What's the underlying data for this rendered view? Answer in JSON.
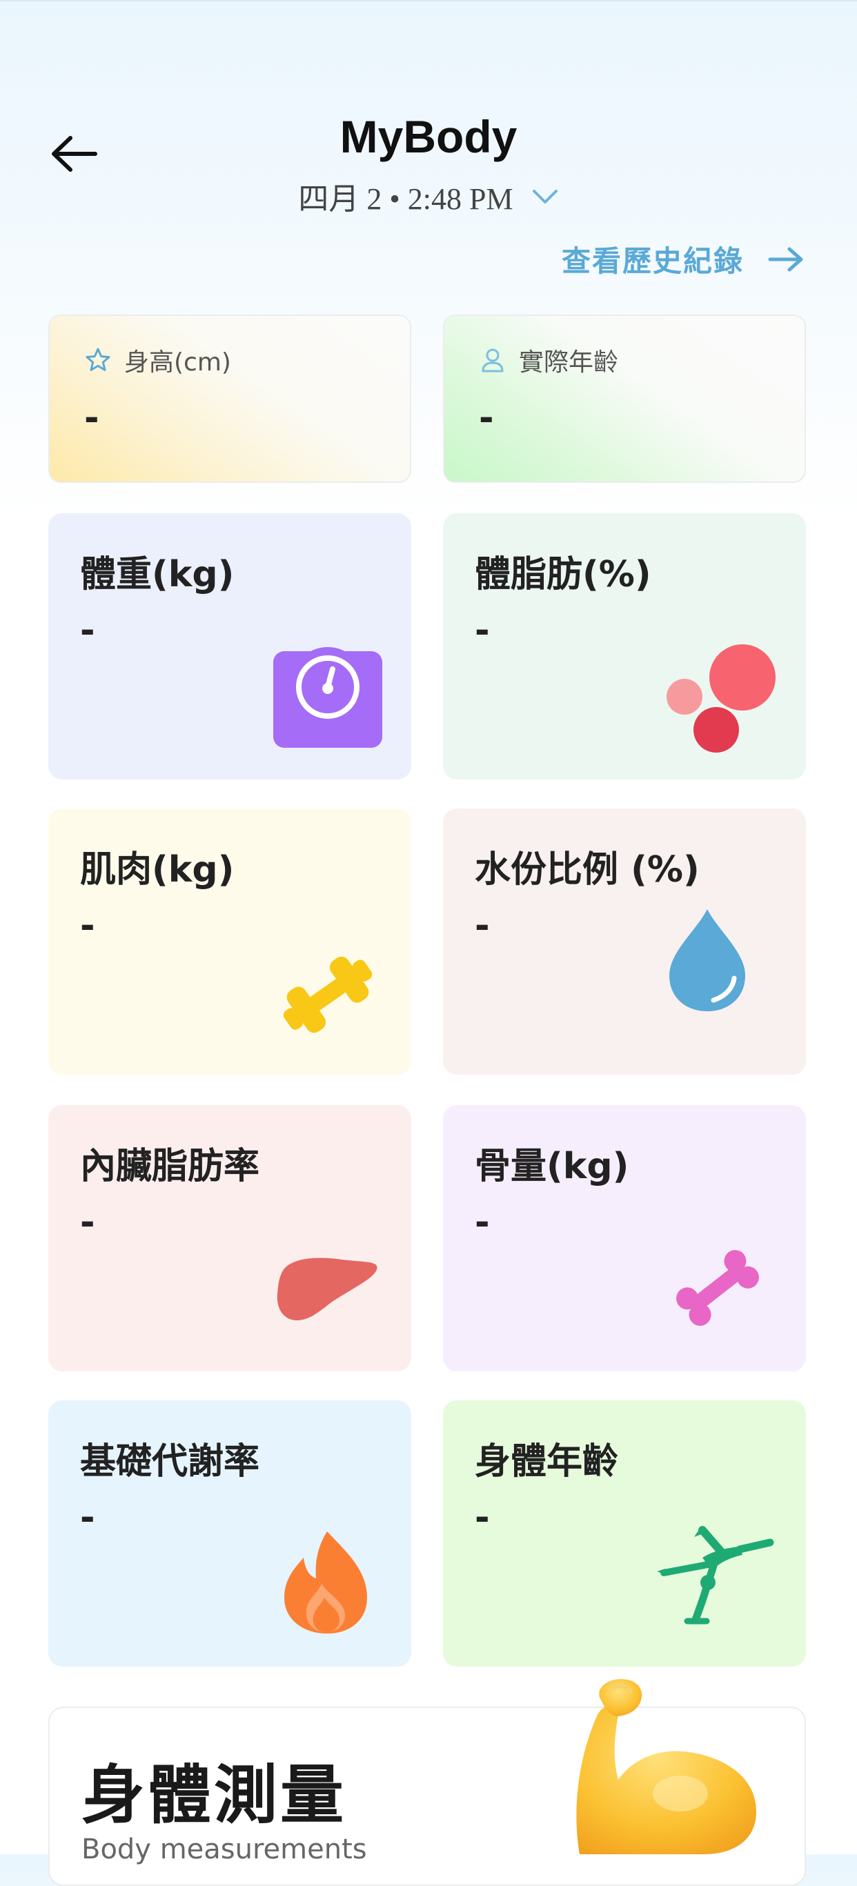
{
  "header": {
    "title": "MyBody",
    "date": "四月 2 • 2:48 PM",
    "history_link": "查看歷史紀錄"
  },
  "info_cards": [
    {
      "label": "身高(cm)",
      "value": "-",
      "icon": "star-icon"
    },
    {
      "label": "實際年齡",
      "value": "-",
      "icon": "person-icon"
    }
  ],
  "metrics": [
    {
      "title": "體重(kg)",
      "value": "-",
      "icon": "scale-icon",
      "color": "#a56cf7",
      "bg": "#ecf0fd"
    },
    {
      "title": "體脂肪(%)",
      "value": "-",
      "icon": "fat-cells-icon",
      "color": "#f2626e",
      "bg": "#ecf7f2"
    },
    {
      "title": "肌肉(kg)",
      "value": "-",
      "icon": "dumbbell-icon",
      "color": "#f9c816",
      "bg": "#fffbeb"
    },
    {
      "title": "水份比例 (%)",
      "value": "-",
      "icon": "water-drop-icon",
      "color": "#5aa9d6",
      "bg": "#f8f1f0"
    },
    {
      "title": "內臟脂肪率",
      "value": "-",
      "icon": "liver-icon",
      "color": "#e46762",
      "bg": "#fdeeee"
    },
    {
      "title": "骨量(kg)",
      "value": "-",
      "icon": "bone-icon",
      "color": "#e866c6",
      "bg": "#f6eefd"
    },
    {
      "title": "基礎代謝率",
      "value": "-",
      "icon": "flame-icon",
      "color": "#fb7f33",
      "bg": "#e6f4fd"
    },
    {
      "title": "身體年齡",
      "value": "-",
      "icon": "cartwheel-icon",
      "color": "#1faa74",
      "bg": "#e6fbdc"
    }
  ],
  "measurements": {
    "title": "身體測量",
    "subtitle": "Body measurements"
  },
  "colors": {
    "accent": "#5aa9d6",
    "star_icon": "#5aa9d6",
    "person_icon": "#7cbfe0"
  }
}
